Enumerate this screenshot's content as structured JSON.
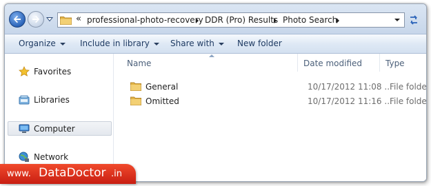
{
  "address": {
    "chevrons": "«",
    "crumbs": [
      "professional-photo-recovery",
      "DDR (Pro) Results",
      "Photo Search"
    ]
  },
  "toolbar": {
    "organize": "Organize",
    "include_in_library": "Include in library",
    "share_with": "Share with",
    "new_folder": "New folder"
  },
  "nav": {
    "favorites": "Favorites",
    "libraries": "Libraries",
    "computer": "Computer",
    "network": "Network"
  },
  "columns": {
    "name": "Name",
    "date_modified": "Date modified",
    "type": "Type"
  },
  "files": [
    {
      "name": "General",
      "date": "10/17/2012 11:08 ...",
      "type": "File folder"
    },
    {
      "name": "Omitted",
      "date": "10/17/2012 11:16 ...",
      "type": "File folder"
    }
  ],
  "brand": {
    "prefix": "www.",
    "name": "DataDoctor",
    "suffix": ".in"
  },
  "colors": {
    "accent": "#2b64b9",
    "brand_red": "#d8281a",
    "folder": "#e7bd4f"
  },
  "icons": {
    "back": "back-arrow-icon",
    "forward": "forward-arrow-icon",
    "refresh": "refresh-icon",
    "folder": "folder-icon",
    "favorites": "star-icon",
    "libraries": "library-icon",
    "computer": "computer-icon",
    "network": "network-icon"
  }
}
